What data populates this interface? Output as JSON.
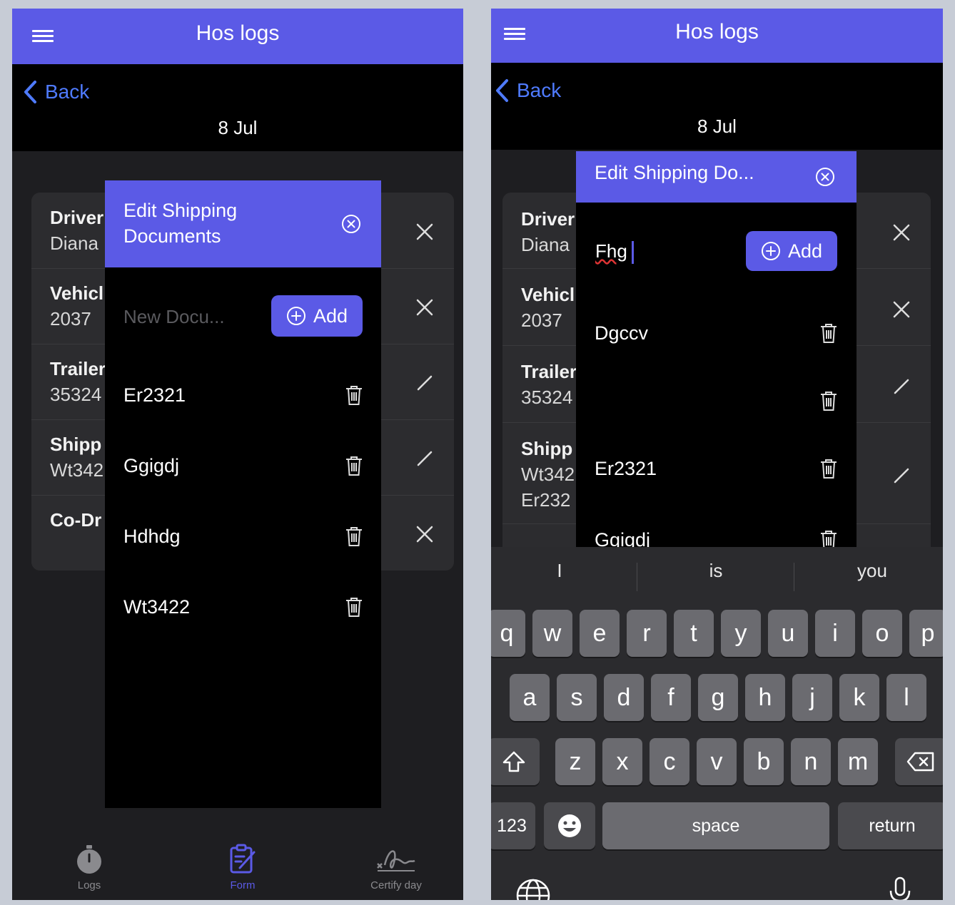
{
  "app": {
    "title": "Hos logs",
    "back_label": "Back",
    "date": "8 Jul"
  },
  "summary_rows": [
    {
      "label": "Driver",
      "value": "Diana",
      "action_icon": "close-icon"
    },
    {
      "label": "Vehicl",
      "value": "2037",
      "action_icon": "close-icon"
    },
    {
      "label": "Trailer",
      "value": "35324",
      "action_icon": "pencil-icon"
    },
    {
      "label": "Shipp",
      "value": "Wt342",
      "value2": "Er232",
      "action_icon": "pencil-icon"
    },
    {
      "label": "Co-Dr",
      "value": "",
      "action_icon": "close-icon"
    }
  ],
  "left_modal": {
    "title_line1": "Edit Shipping",
    "title_line2": "Documents",
    "input_placeholder": "New Docu...",
    "add_label": "Add",
    "documents": [
      "Er2321",
      "Ggigdj",
      "Hdhdg",
      "Wt3422"
    ]
  },
  "right_modal": {
    "title": "Edit Shipping Do...",
    "input_value": "Fhg",
    "add_label": "Add",
    "documents": [
      "Dgccv",
      "",
      "Er2321",
      "Ggigdj"
    ]
  },
  "tabbar": {
    "tabs": [
      {
        "label": "Logs",
        "icon": "stopwatch-icon",
        "active": false
      },
      {
        "label": "Form",
        "icon": "form-icon",
        "active": true
      },
      {
        "label": "Certify day",
        "icon": "signature-icon",
        "active": false
      }
    ]
  },
  "keyboard": {
    "suggestions": [
      "I",
      "is",
      "you"
    ],
    "row1": [
      "q",
      "w",
      "e",
      "r",
      "t",
      "y",
      "u",
      "i",
      "o",
      "p"
    ],
    "row2": [
      "a",
      "s",
      "d",
      "f",
      "g",
      "h",
      "j",
      "k",
      "l"
    ],
    "row3": [
      "z",
      "x",
      "c",
      "v",
      "b",
      "n",
      "m"
    ],
    "numbers_label": "123",
    "space_label": "space",
    "return_label": "return"
  },
  "colors": {
    "accent": "#5b5ae6",
    "link": "#4f7bff",
    "background": "#1e1e21",
    "modal": "#000000"
  }
}
